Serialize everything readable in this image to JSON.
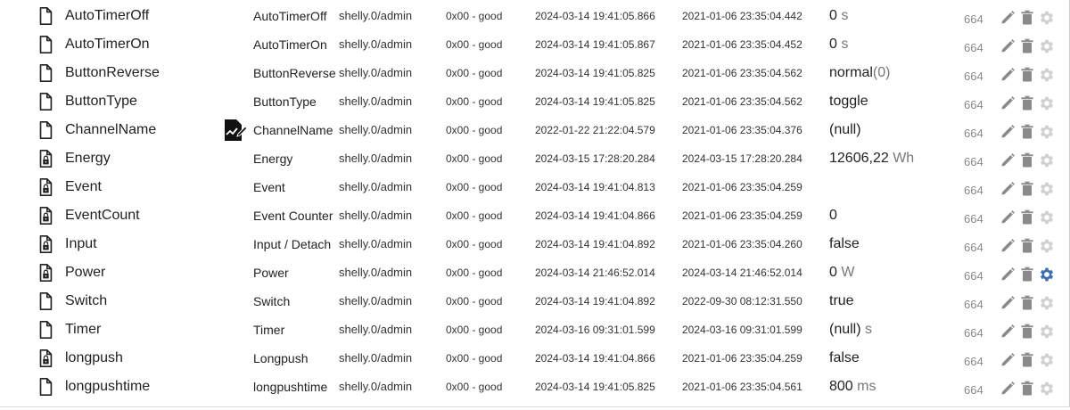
{
  "table": {
    "rows": [
      {
        "id": "AutoTimerOff",
        "name": "AutoTimerOff",
        "role": "shelly.0/admin",
        "quality": "0x00 - good",
        "ts": "2024-03-14 19:41:05.866",
        "lc": "2021-01-06 23:35:04.442",
        "value": "0",
        "unit": "s",
        "acl": "664",
        "icon": "file-icon"
      },
      {
        "id": "AutoTimerOn",
        "name": "AutoTimerOn",
        "role": "shelly.0/admin",
        "quality": "0x00 - good",
        "ts": "2024-03-14 19:41:05.867",
        "lc": "2021-01-06 23:35:04.452",
        "value": "0",
        "unit": "s",
        "acl": "664",
        "icon": "file-icon"
      },
      {
        "id": "ButtonReverse",
        "name": "ButtonReverse",
        "role": "shelly.0/admin",
        "quality": "0x00 - good",
        "ts": "2024-03-14 19:41:05.825",
        "lc": "2021-01-06 23:35:04.562",
        "value": "normal",
        "unit": "(0)",
        "acl": "664",
        "icon": "file-icon"
      },
      {
        "id": "ButtonType",
        "name": "ButtonType",
        "role": "shelly.0/admin",
        "quality": "0x00 - good",
        "ts": "2024-03-14 19:41:05.825",
        "lc": "2021-01-06 23:35:04.562",
        "value": "toggle",
        "unit": "",
        "acl": "664",
        "icon": "file-icon"
      },
      {
        "id": "ChannelName",
        "name": "ChannelName",
        "role": "shelly.0/admin",
        "quality": "0x00 - good",
        "ts": "2022-01-22 21:22:04.579",
        "lc": "2021-01-06 23:35:04.376",
        "value": "(null)",
        "unit": "",
        "acl": "664",
        "icon": "file-icon",
        "editable": true
      },
      {
        "id": "Energy",
        "name": "Energy",
        "role": "shelly.0/admin",
        "quality": "0x00 - good",
        "ts": "2024-03-15 17:28:20.284",
        "lc": "2024-03-15 17:28:20.284",
        "value": "12606,22",
        "unit": "Wh",
        "acl": "664",
        "icon": "locked-file-icon"
      },
      {
        "id": "Event",
        "name": "Event",
        "role": "shelly.0/admin",
        "quality": "0x00 - good",
        "ts": "2024-03-14 19:41:04.813",
        "lc": "2021-01-06 23:35:04.259",
        "value": "",
        "unit": "",
        "acl": "664",
        "icon": "locked-file-icon"
      },
      {
        "id": "EventCount",
        "name": "Event Counter",
        "role": "shelly.0/admin",
        "quality": "0x00 - good",
        "ts": "2024-03-14 19:41:04.866",
        "lc": "2021-01-06 23:35:04.259",
        "value": "0",
        "unit": "",
        "acl": "664",
        "icon": "locked-file-icon"
      },
      {
        "id": "Input",
        "name": "Input / Detach",
        "role": "shelly.0/admin",
        "quality": "0x00 - good",
        "ts": "2024-03-14 19:41:04.892",
        "lc": "2021-01-06 23:35:04.260",
        "value": "false",
        "unit": "",
        "acl": "664",
        "icon": "locked-file-icon"
      },
      {
        "id": "Power",
        "name": "Power",
        "role": "shelly.0/admin",
        "quality": "0x00 - good",
        "ts": "2024-03-14 21:46:52.014",
        "lc": "2024-03-14 21:46:52.014",
        "value": "0",
        "unit": "W",
        "acl": "664",
        "icon": "locked-file-icon",
        "gear_active": true
      },
      {
        "id": "Switch",
        "name": "Switch",
        "role": "shelly.0/admin",
        "quality": "0x00 - good",
        "ts": "2024-03-14 19:41:04.892",
        "lc": "2022-09-30 08:12:31.550",
        "value": "true",
        "unit": "",
        "acl": "664",
        "icon": "file-icon"
      },
      {
        "id": "Timer",
        "name": "Timer",
        "role": "shelly.0/admin",
        "quality": "0x00 - good",
        "ts": "2024-03-16 09:31:01.599",
        "lc": "2024-03-16 09:31:01.599",
        "value": "(null)",
        "unit": "s",
        "acl": "664",
        "icon": "file-icon"
      },
      {
        "id": "longpush",
        "name": "Longpush",
        "role": "shelly.0/admin",
        "quality": "0x00 - good",
        "ts": "2024-03-14 19:41:04.866",
        "lc": "2021-01-06 23:35:04.259",
        "value": "false",
        "unit": "",
        "acl": "664",
        "icon": "locked-file-icon"
      },
      {
        "id": "longpushtime",
        "name": "longpushtime",
        "role": "shelly.0/admin",
        "quality": "0x00 - good",
        "ts": "2024-03-14 19:41:05.825",
        "lc": "2021-01-06 23:35:04.561",
        "value": "800",
        "unit": "ms",
        "acl": "664",
        "icon": "file-icon"
      }
    ]
  },
  "colors": {
    "action_icon": "#8a8a8a",
    "gear_inactive": "#d0d0d0",
    "gear_active": "#3b6fb6",
    "text": "#222222"
  }
}
